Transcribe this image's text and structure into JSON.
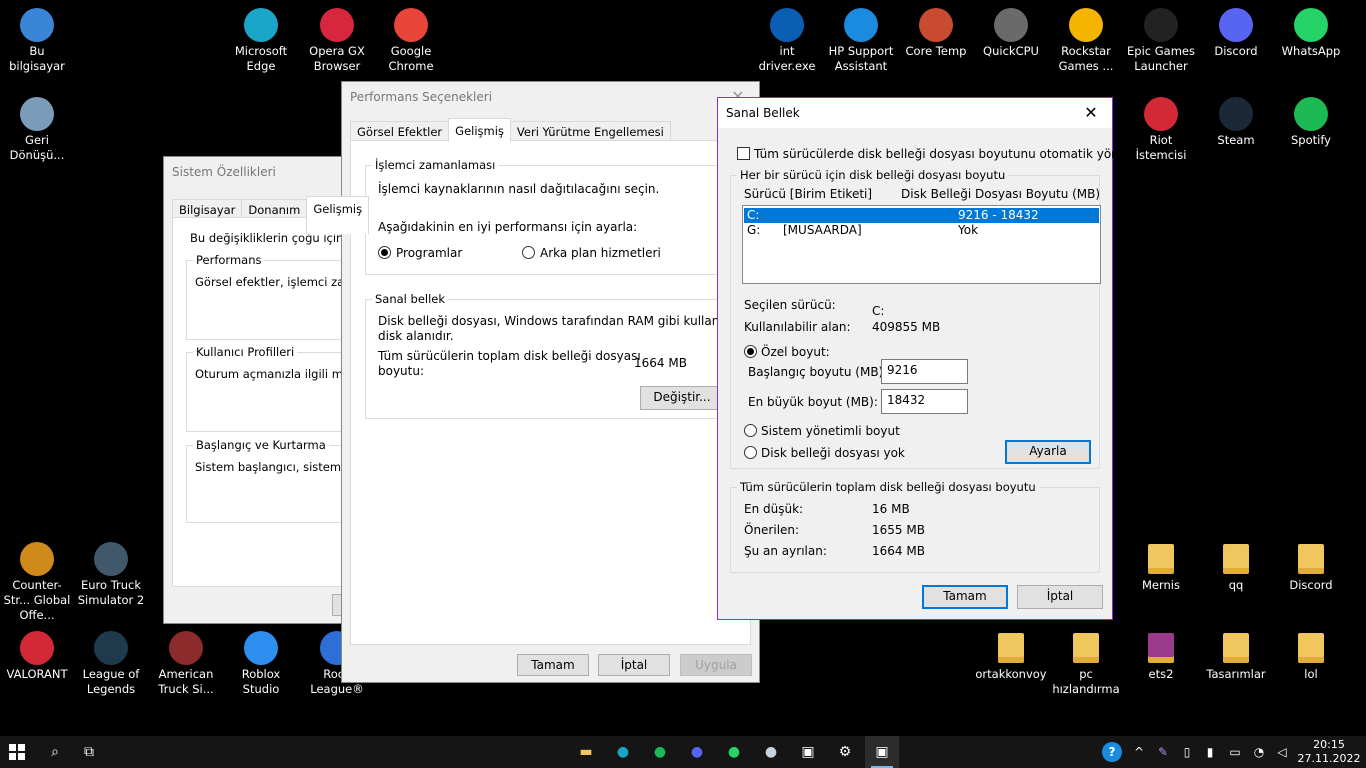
{
  "desktop": {
    "icons": [
      {
        "label": "Bu bilgisayar",
        "icon": "computer-icon",
        "color": "#3a86d6"
      },
      {
        "label": "Geri Dönüşü...",
        "icon": "recycle-bin-icon",
        "color": "#7a9cb8"
      },
      {
        "label": "Microsoft Edge",
        "icon": "edge-icon",
        "color": "#1aa6c8"
      },
      {
        "label": "Opera GX Browser",
        "icon": "opera-gx-icon",
        "color": "#d7263d"
      },
      {
        "label": "Google Chrome",
        "icon": "chrome-icon",
        "color": "#e8443a"
      },
      {
        "label": "int driver.exe",
        "icon": "hp-icon",
        "color": "#0a5fb4"
      },
      {
        "label": "HP Support Assistant",
        "icon": "help-icon",
        "color": "#1b8be0"
      },
      {
        "label": "Core Temp",
        "icon": "core-temp-icon",
        "color": "#c84b31"
      },
      {
        "label": "QuickCPU",
        "icon": "quickcpu-icon",
        "color": "#6a6a6a"
      },
      {
        "label": "Rockstar Games ...",
        "icon": "rockstar-icon",
        "color": "#f5b400"
      },
      {
        "label": "Epic Games Launcher",
        "icon": "epic-games-icon",
        "color": "#222222"
      },
      {
        "label": "Discord",
        "icon": "discord-icon",
        "color": "#5865f2"
      },
      {
        "label": "WhatsApp",
        "icon": "whatsapp-icon",
        "color": "#25d366"
      },
      {
        "label": "Riot İstemcisi",
        "icon": "riot-icon",
        "color": "#d32936"
      },
      {
        "label": "Steam",
        "icon": "steam-icon",
        "color": "#1b2838"
      },
      {
        "label": "Spotify",
        "icon": "spotify-icon",
        "color": "#1db954"
      },
      {
        "label": "Counter-Str... Global Offe...",
        "icon": "csgo-icon",
        "color": "#d08a1c"
      },
      {
        "label": "Euro Truck Simulator 2",
        "icon": "ets2-icon",
        "color": "#40586a"
      },
      {
        "label": "VALORANT",
        "icon": "valorant-icon",
        "color": "#d32936"
      },
      {
        "label": "League of Legends",
        "icon": "lol-icon",
        "color": "#1f3a4d"
      },
      {
        "label": "American Truck Si...",
        "icon": "ats-icon",
        "color": "#8b2b2b"
      },
      {
        "label": "Roblox Studio",
        "icon": "roblox-studio-icon",
        "color": "#2d8ef0"
      },
      {
        "label": "Rock League®",
        "icon": "rocket-league-icon",
        "color": "#2d6fd6"
      },
      {
        "label": "Mernis",
        "icon": "folder-icon",
        "color": "#f0c75e"
      },
      {
        "label": "qq",
        "icon": "folder-icon",
        "color": "#f0c75e"
      },
      {
        "label": "Discord",
        "icon": "folder-icon",
        "color": "#f0c75e"
      },
      {
        "label": "ortakkonvoy",
        "icon": "folder-icon",
        "color": "#f0c75e"
      },
      {
        "label": "pc hızlandırma",
        "icon": "pdf-icon",
        "color": "#f0c75e"
      },
      {
        "label": "ets2",
        "icon": "winrar-icon",
        "color": "#9b3a8c"
      },
      {
        "label": "Tasarımlar",
        "icon": "folder-icon",
        "color": "#f0c75e"
      },
      {
        "label": "lol",
        "icon": "folder-icon",
        "color": "#f0c75e"
      }
    ]
  },
  "system_props": {
    "title": "Sistem Özellikleri",
    "tabs": [
      "Bilgisayar Adı",
      "Donanım",
      "Gelişmiş"
    ],
    "intro": "Bu değişikliklerin çoğu için Yönet",
    "performans_legend": "Performans",
    "performans_text": "Görsel efektler, işlemci zamanla",
    "profil_legend": "Kullanıcı Profilleri",
    "profil_text": "Oturum açmanızla ilgili masaüstü",
    "baslangic_legend": "Başlangıç ve Kurtarma",
    "baslangic_text": "Sistem başlangıcı, sistem hatası"
  },
  "perf_options": {
    "title": "Performans Seçenekleri",
    "tabs": [
      "Görsel Efektler",
      "Gelişmiş",
      "Veri Yürütme Engellemesi"
    ],
    "cpu_legend": "İşlemci zamanlaması",
    "cpu_desc": "İşlemci kaynaklarının nasıl dağıtılacağını seçin.",
    "cpu_adjust": "Aşağıdakinin en iyi performansı için ayarla:",
    "radio_programs": "Programlar",
    "radio_background": "Arka plan hizmetleri",
    "vm_legend": "Sanal bellek",
    "vm_desc1": "Disk belleği dosyası, Windows tarafından RAM gibi kullanılan sab",
    "vm_desc2": "disk alanıdır.",
    "vm_total1": "Tüm sürücülerin toplam disk belleği dosyası",
    "vm_total2": "boyutu:",
    "vm_total_value": "1664 MB",
    "change_button": "Değiştir...",
    "ok": "Tamam",
    "cancel": "İptal",
    "apply": "Uygula"
  },
  "virtual_memory": {
    "title": "Sanal Bellek",
    "auto_manage": "Tüm sürücülerde disk belleği dosyası boyutunu otomatik yönet",
    "per_drive_legend": "Her bir sürücü için disk belleği dosyası boyutu",
    "col_drive": "Sürücü  [Birim Etiketi]",
    "col_size": "Disk Belleği Dosyası Boyutu (MB)",
    "drives": [
      {
        "drive": "C:",
        "label": "",
        "size": "9216 - 18432"
      },
      {
        "drive": "G:",
        "label": "[MUSAARDA]",
        "size": "Yok"
      }
    ],
    "selected_drive_label": "Seçilen sürücü:",
    "selected_drive_value": "C:",
    "available_label": "Kullanılabilir alan:",
    "available_value": "409855 MB",
    "custom_size": "Özel boyut:",
    "initial_label": "Başlangıç boyutu (MB):",
    "initial_value": "9216",
    "max_label": "En büyük boyut (MB):",
    "max_value": "18432",
    "system_managed": "Sistem yönetimli boyut",
    "no_paging": "Disk belleği dosyası yok",
    "set_button": "Ayarla",
    "total_legend": "Tüm sürücülerin toplam disk belleği dosyası boyutu",
    "min_label": "En düşük:",
    "min_value": "16 MB",
    "recommended_label": "Önerilen:",
    "recommended_value": "1655 MB",
    "current_label": "Şu an ayrılan:",
    "current_value": "1664 MB",
    "ok": "Tamam",
    "cancel": "İptal",
    "accent": "#8a2be2"
  },
  "taskbar": {
    "time": "20:15",
    "date": "27.11.2022"
  }
}
